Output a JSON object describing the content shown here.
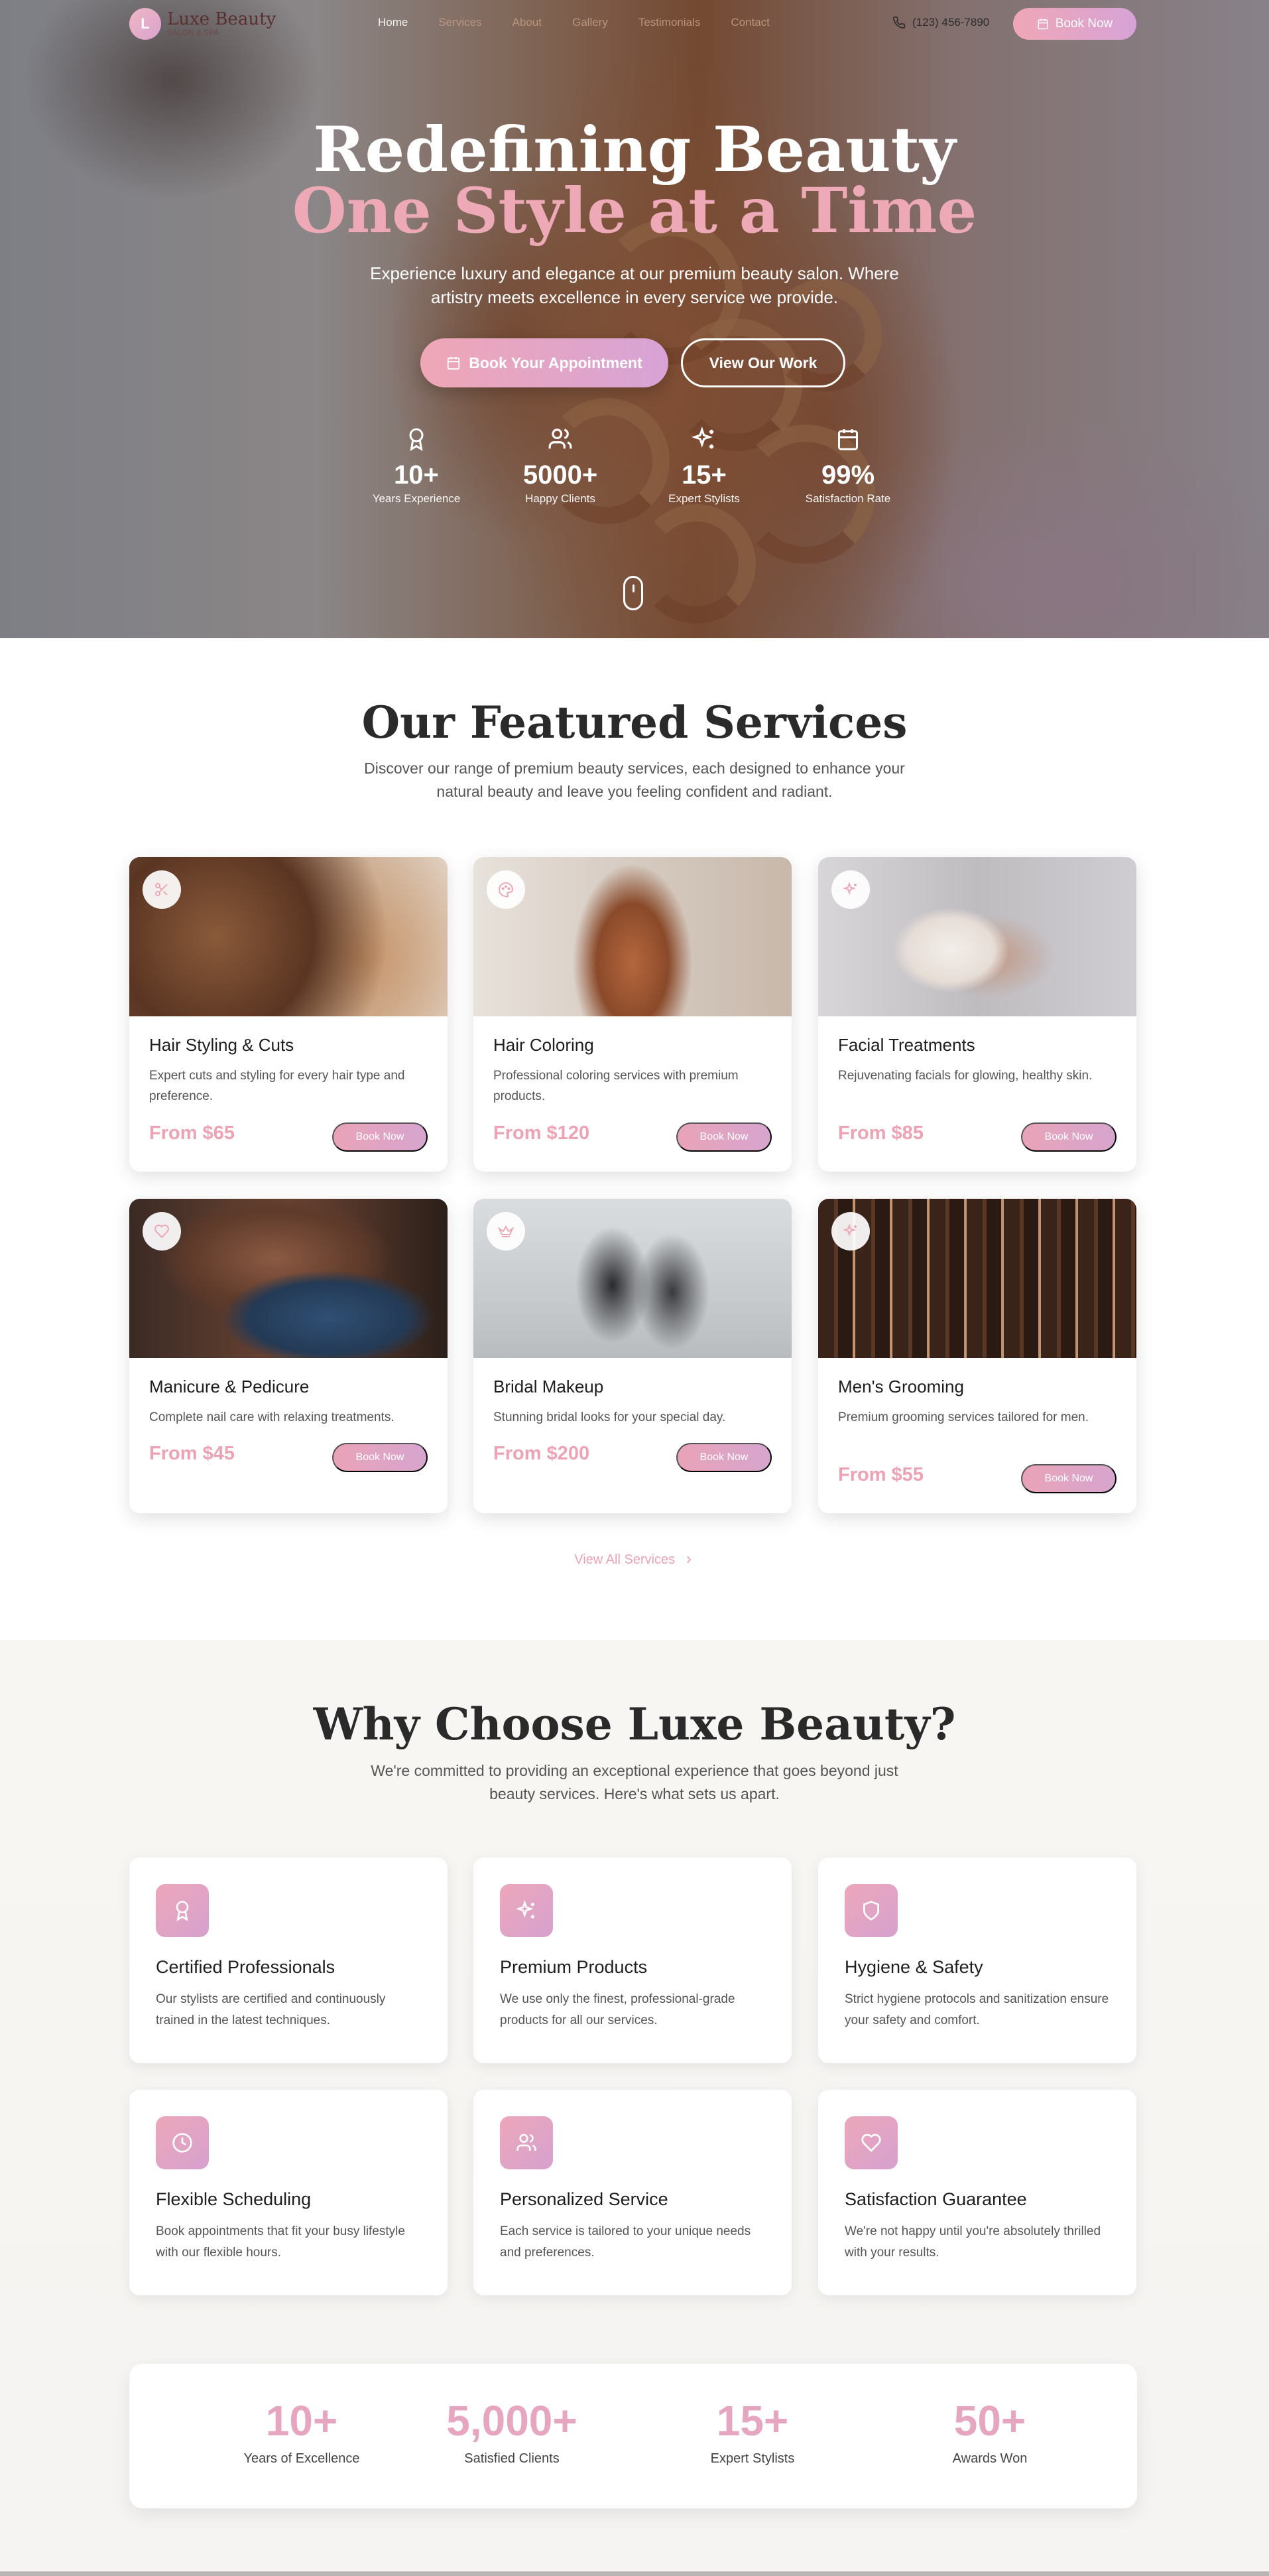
{
  "nav": {
    "logo_letter": "L",
    "logo_text": "Luxe Beauty",
    "logo_sub": "SALON & SPA",
    "links": [
      "Home",
      "Services",
      "About",
      "Gallery",
      "Testimonials",
      "Contact"
    ],
    "phone": "(123) 456-7890",
    "book_label": "Book Now"
  },
  "hero": {
    "title_line1": "Redefining Beauty",
    "title_line2": "One Style at a Time",
    "description": "Experience luxury and elegance at our premium beauty salon. Where artistry meets excellence in every service we provide.",
    "primary_button": "Book Your Appointment",
    "secondary_button": "View Our Work",
    "stats": [
      {
        "icon": "award-icon",
        "value": "10+",
        "label": "Years Experience"
      },
      {
        "icon": "users-icon",
        "value": "5000+",
        "label": "Happy Clients"
      },
      {
        "icon": "sparkles-icon",
        "value": "15+",
        "label": "Expert Stylists"
      },
      {
        "icon": "calendar-icon",
        "value": "99%",
        "label": "Satisfaction Rate"
      }
    ]
  },
  "services": {
    "title": "Our Featured Services",
    "description": "Discover our range of premium beauty services, each designed to enhance your natural beauty and leave you feeling confident and radiant.",
    "items": [
      {
        "icon": "scissors-icon",
        "title": "Hair Styling & Cuts",
        "description": "Expert cuts and styling for every hair type and preference.",
        "price": "From $65",
        "button": "Book Now"
      },
      {
        "icon": "palette-icon",
        "title": "Hair Coloring",
        "description": "Professional coloring services with premium products.",
        "price": "From $120",
        "button": "Book Now"
      },
      {
        "icon": "sparkles-icon",
        "title": "Facial Treatments",
        "description": "Rejuvenating facials for glowing, healthy skin.",
        "price": "From $85",
        "button": "Book Now"
      },
      {
        "icon": "heart-icon",
        "title": "Manicure & Pedicure",
        "description": "Complete nail care with relaxing treatments.",
        "price": "From $45",
        "button": "Book Now"
      },
      {
        "icon": "crown-icon",
        "title": "Bridal Makeup",
        "description": "Stunning bridal looks for your special day.",
        "price": "From $200",
        "button": "Book Now"
      },
      {
        "icon": "sparkles-icon",
        "title": "Men's Grooming",
        "description": "Premium grooming services tailored for men.",
        "price": "From $55",
        "button": "Book Now"
      }
    ],
    "view_all": "View All Services"
  },
  "why": {
    "title": "Why Choose Luxe Beauty?",
    "description": "We're committed to providing an exceptional experience that goes beyond just beauty services. Here's what sets us apart.",
    "features": [
      {
        "icon": "award-icon",
        "title": "Certified Professionals",
        "description": "Our stylists are certified and continuously trained in the latest techniques."
      },
      {
        "icon": "sparkles-icon",
        "title": "Premium Products",
        "description": "We use only the finest, professional-grade products for all our services."
      },
      {
        "icon": "shield-icon",
        "title": "Hygiene & Safety",
        "description": "Strict hygiene protocols and sanitization ensure your safety and comfort."
      },
      {
        "icon": "clock-icon",
        "title": "Flexible Scheduling",
        "description": "Book appointments that fit your busy lifestyle with our flexible hours."
      },
      {
        "icon": "users-icon",
        "title": "Personalized Service",
        "description": "Each service is tailored to your unique needs and preferences."
      },
      {
        "icon": "heart-icon",
        "title": "Satisfaction Guarantee",
        "description": "We're not happy until you're absolutely thrilled with your results."
      }
    ],
    "stats": [
      {
        "value": "10+",
        "label": "Years of Excellence"
      },
      {
        "value": "5,000+",
        "label": "Satisfied Clients"
      },
      {
        "value": "15+",
        "label": "Expert Stylists"
      },
      {
        "value": "50+",
        "label": "Awards Won"
      }
    ]
  },
  "colors": {
    "accent_pink": "#eea9b7",
    "accent_lilac": "#d7a3d6"
  }
}
